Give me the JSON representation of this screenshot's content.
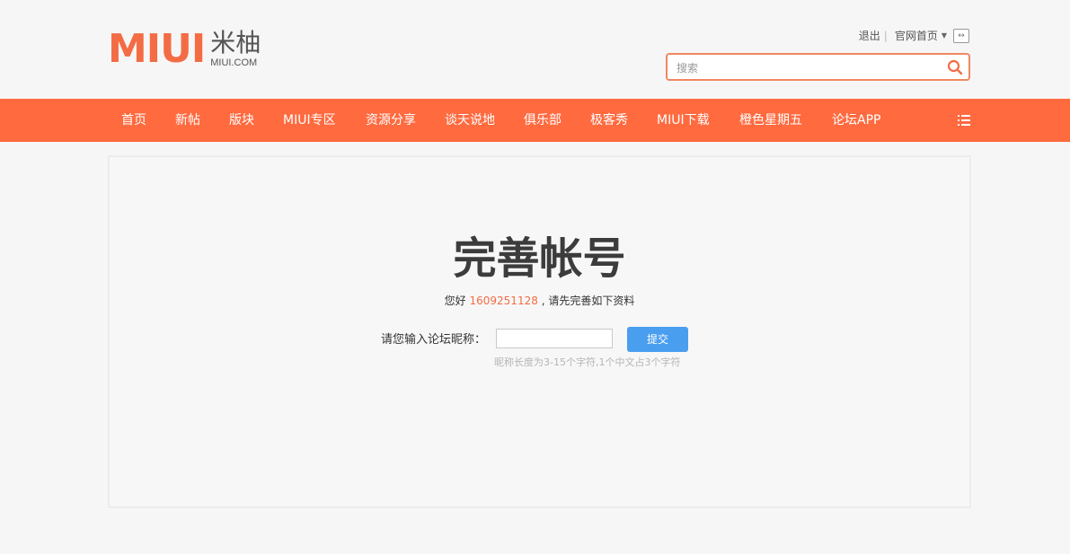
{
  "brand": {
    "logo_text": "MIUI",
    "logo_cn": "米柚",
    "domain": "MIUI.COM",
    "accent_color": "#f36c44"
  },
  "toplinks": {
    "logout": "退出",
    "separator": "|",
    "home": "官网首页"
  },
  "search": {
    "placeholder": "搜索",
    "icon": "search-icon"
  },
  "nav": {
    "background": "#ff6a3f",
    "items": [
      "首页",
      "新帖",
      "版块",
      "MIUI专区",
      "资源分享",
      "谈天说地",
      "俱乐部",
      "极客秀",
      "MIUI下载",
      "橙色星期五",
      "论坛APP"
    ],
    "menu_icon": "list-icon"
  },
  "main": {
    "title": "完善帐号",
    "greeting": "您好",
    "user_id": "1609251128",
    "greeting_suffix": ", 请先完善如下资料",
    "nickname_label": "请您输入论坛昵称：",
    "nickname_value": "",
    "submit_label": "提交",
    "hint": "昵称长度为3-15个字符,1个中文占3个字符"
  }
}
